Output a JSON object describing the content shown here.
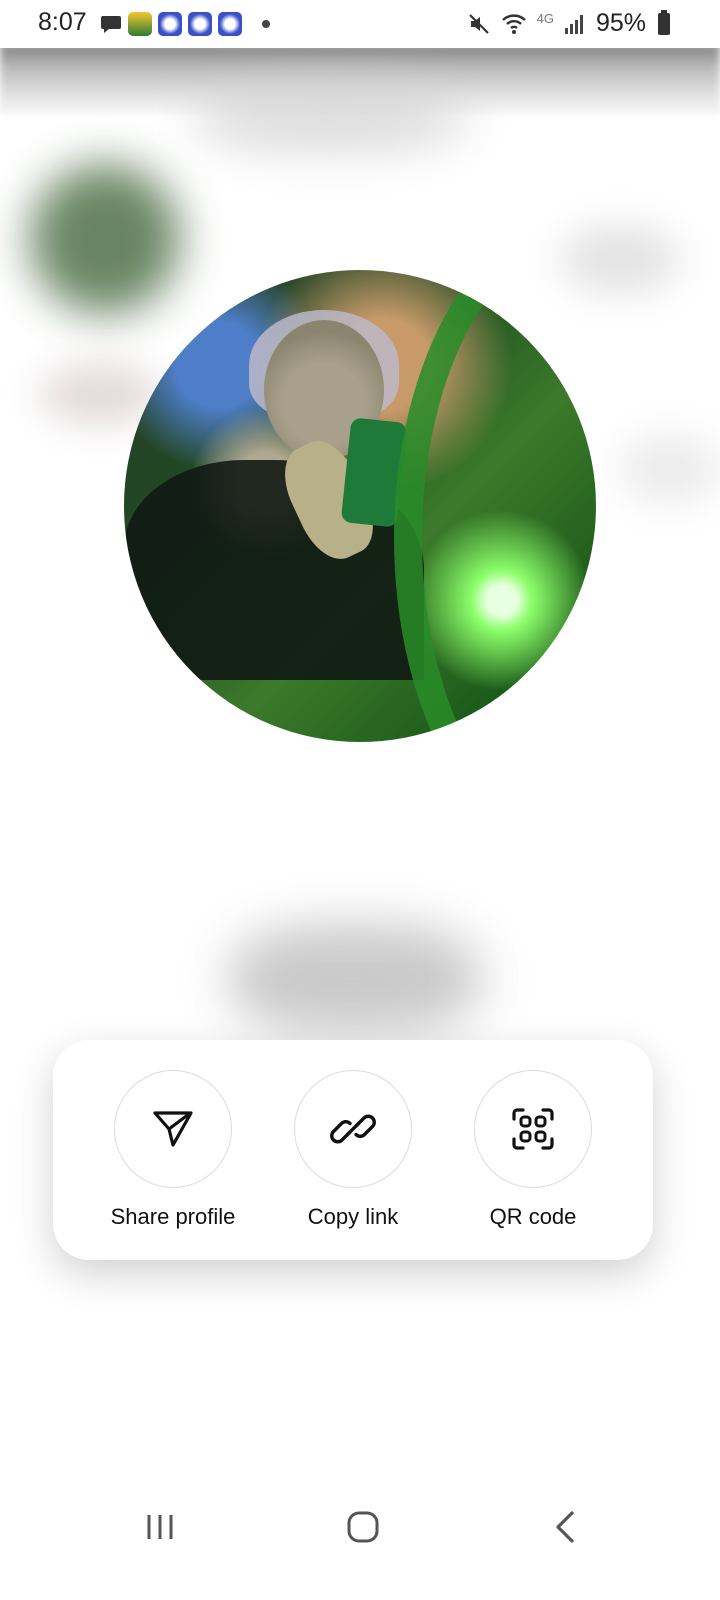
{
  "status_bar": {
    "time": "8:07",
    "battery": "95%",
    "network_label": "4G",
    "notification_icons": [
      "message-icon",
      "slot-app-icon",
      "jackpot-app-icon",
      "jackpot-app-icon",
      "jackpot-app-icon"
    ]
  },
  "actions": [
    {
      "label": "Share profile",
      "icon": "send-icon"
    },
    {
      "label": "Copy link",
      "icon": "link-icon"
    },
    {
      "label": "QR code",
      "icon": "qr-code-icon"
    }
  ],
  "nav": {
    "buttons": [
      "recent-apps",
      "home",
      "back"
    ]
  },
  "colors": {
    "card_bg": "#ffffff",
    "text": "#111111",
    "circle_border": "#dcdcdc"
  }
}
